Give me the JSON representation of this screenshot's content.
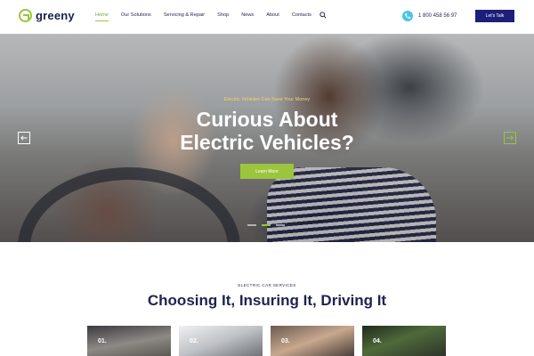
{
  "brand": {
    "name": "greeny",
    "accent": "#9bc53d",
    "navy": "#1f234f"
  },
  "nav": {
    "items": [
      {
        "label": "Home",
        "active": true
      },
      {
        "label": "Our Solutions",
        "active": false
      },
      {
        "label": "Servicing & Repair",
        "active": false
      },
      {
        "label": "Shop",
        "active": false
      },
      {
        "label": "News",
        "active": false
      },
      {
        "label": "About",
        "active": false
      },
      {
        "label": "Contacts",
        "active": false
      }
    ]
  },
  "header": {
    "search_icon": "search-icon",
    "phone_icon": "phone-icon",
    "phone": "1 800 458 56 97",
    "cta_label": "Let's Talk"
  },
  "hero": {
    "subtitle": "Electric Vehicles Can Save Your Money",
    "title_line1": "Curious About",
    "title_line2": "Electric Vehicles?",
    "button_label": "Learn More",
    "slides": 3,
    "active_slide": 2
  },
  "section": {
    "eyebrow": "ELECTRIC CAR SERVICES",
    "title": "Choosing It, Insuring It, Driving It"
  },
  "cards": [
    {
      "number": "01."
    },
    {
      "number": "02."
    },
    {
      "number": "03."
    },
    {
      "number": "04."
    }
  ]
}
